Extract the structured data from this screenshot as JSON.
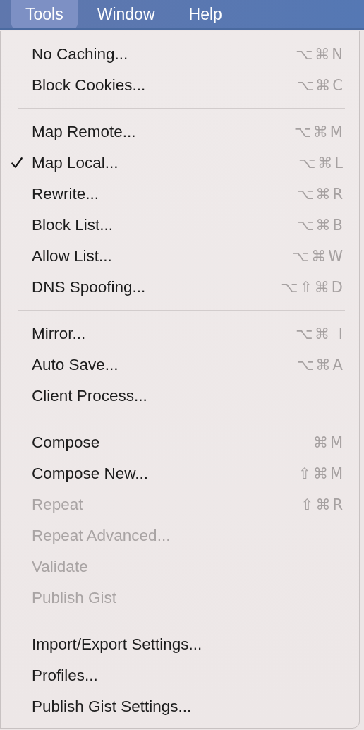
{
  "menu_bar": [
    {
      "label": "Tools",
      "selected": true
    },
    {
      "label": "Window",
      "selected": false
    },
    {
      "label": "Help",
      "selected": false
    }
  ],
  "menu": {
    "sections": [
      {
        "items": [
          {
            "label": "No Caching...",
            "shortcut": "⌥⌘N",
            "checked": false,
            "disabled": false
          },
          {
            "label": "Block Cookies...",
            "shortcut": "⌥⌘C",
            "checked": false,
            "disabled": false
          }
        ]
      },
      {
        "items": [
          {
            "label": "Map Remote...",
            "shortcut": "⌥⌘M",
            "checked": false,
            "disabled": false
          },
          {
            "label": "Map Local...",
            "shortcut": "⌥⌘L",
            "checked": true,
            "disabled": false
          },
          {
            "label": "Rewrite...",
            "shortcut": "⌥⌘R",
            "checked": false,
            "disabled": false
          },
          {
            "label": "Block List...",
            "shortcut": "⌥⌘B",
            "checked": false,
            "disabled": false
          },
          {
            "label": "Allow List...",
            "shortcut": "⌥⌘W",
            "checked": false,
            "disabled": false
          },
          {
            "label": "DNS Spoofing...",
            "shortcut": "⌥⇧⌘D",
            "checked": false,
            "disabled": false
          }
        ]
      },
      {
        "items": [
          {
            "label": "Mirror...",
            "shortcut": "⌥⌘ I",
            "checked": false,
            "disabled": false
          },
          {
            "label": "Auto Save...",
            "shortcut": "⌥⌘A",
            "checked": false,
            "disabled": false
          },
          {
            "label": "Client Process...",
            "checked": false,
            "disabled": false
          }
        ]
      },
      {
        "items": [
          {
            "label": "Compose",
            "shortcut": "⌘M",
            "checked": false,
            "disabled": false
          },
          {
            "label": "Compose New...",
            "shortcut": "⇧⌘M",
            "checked": false,
            "disabled": false
          },
          {
            "label": "Repeat",
            "shortcut": "⇧⌘R",
            "checked": false,
            "disabled": true
          },
          {
            "label": "Repeat Advanced...",
            "checked": false,
            "disabled": true
          },
          {
            "label": "Validate",
            "checked": false,
            "disabled": true
          },
          {
            "label": "Publish Gist",
            "checked": false,
            "disabled": true
          }
        ]
      },
      {
        "items": [
          {
            "label": "Import/Export Settings...",
            "checked": false,
            "disabled": false
          },
          {
            "label": "Profiles...",
            "checked": false,
            "disabled": false
          },
          {
            "label": "Publish Gist Settings...",
            "checked": false,
            "disabled": false
          }
        ]
      }
    ]
  }
}
